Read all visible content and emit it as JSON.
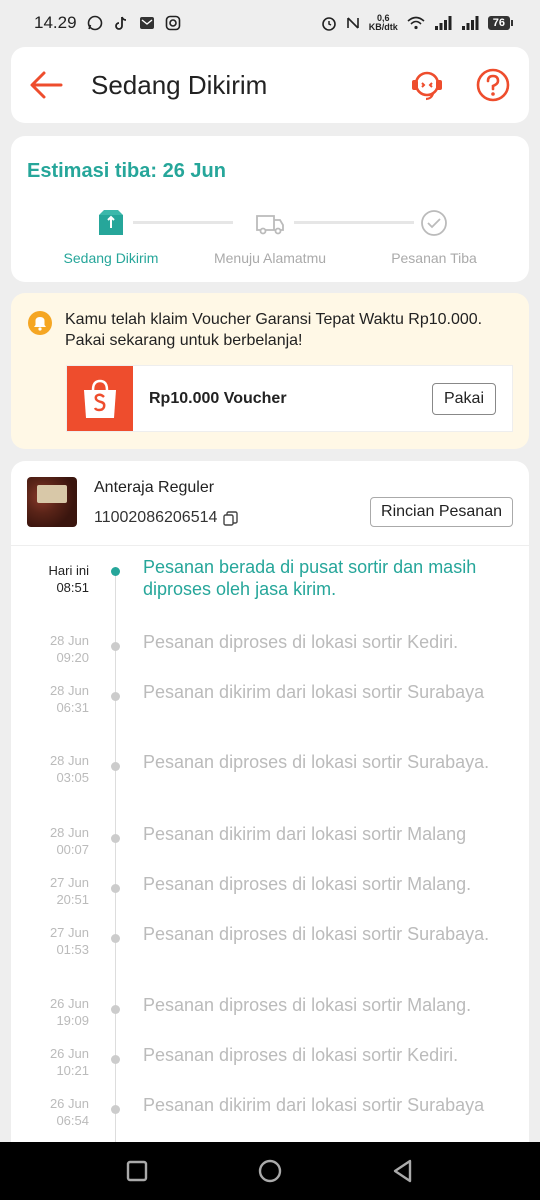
{
  "status_bar": {
    "time": "14.29",
    "net_speed_value": "0,6",
    "net_speed_unit": "KB/dtk",
    "battery": "76"
  },
  "header": {
    "title": "Sedang Dikirim"
  },
  "estimate": {
    "title": "Estimasi tiba: 26 Jun",
    "steps": [
      {
        "label": "Sedang Dikirim",
        "icon": "box-icon",
        "active": true
      },
      {
        "label": "Menuju Alamatmu",
        "icon": "truck-icon",
        "active": false
      },
      {
        "label": "Pesanan Tiba",
        "icon": "check-circle-icon",
        "active": false
      }
    ]
  },
  "voucher": {
    "message": "Kamu telah klaim Voucher Garansi Tepat Waktu Rp10.000. Pakai sekarang untuk berbelanja!",
    "name": "Rp10.000 Voucher",
    "use_label": "Pakai"
  },
  "shipment": {
    "courier": "Anteraja Reguler",
    "tracking_number": "11002086206514",
    "detail_label": "Rincian Pesanan"
  },
  "timeline": [
    {
      "date": "Hari ini",
      "time": "08:51",
      "text": "Pesanan berada di pusat sortir dan masih diproses oleh jasa kirim.",
      "active": true
    },
    {
      "date": "28 Jun",
      "time": "09:20",
      "text": "Pesanan diproses di lokasi sortir  Kediri.",
      "active": false
    },
    {
      "date": "28 Jun",
      "time": "06:31",
      "text": "Pesanan dikirim dari lokasi sortir Surabaya",
      "active": false
    },
    {
      "date": "28 Jun",
      "time": "03:05",
      "text": "Pesanan diproses di lokasi sortir Surabaya.",
      "active": false
    },
    {
      "date": "28 Jun",
      "time": "00:07",
      "text": "Pesanan dikirim dari lokasi sortir  Malang",
      "active": false
    },
    {
      "date": "27 Jun",
      "time": "20:51",
      "text": "Pesanan diproses di lokasi sortir  Malang.",
      "active": false
    },
    {
      "date": "27 Jun",
      "time": "01:53",
      "text": "Pesanan diproses di lokasi sortir Surabaya.",
      "active": false
    },
    {
      "date": "26 Jun",
      "time": "19:09",
      "text": "Pesanan diproses di lokasi sortir  Malang.",
      "active": false
    },
    {
      "date": "26 Jun",
      "time": "10:21",
      "text": "Pesanan diproses di lokasi sortir  Kediri.",
      "active": false
    },
    {
      "date": "26 Jun",
      "time": "06:54",
      "text": "Pesanan dikirim dari lokasi sortir Surabaya",
      "active": false
    }
  ],
  "colors": {
    "accent": "#26a69a",
    "brand": "#ee4d2d",
    "voucher_bg": "#fff8e6"
  }
}
